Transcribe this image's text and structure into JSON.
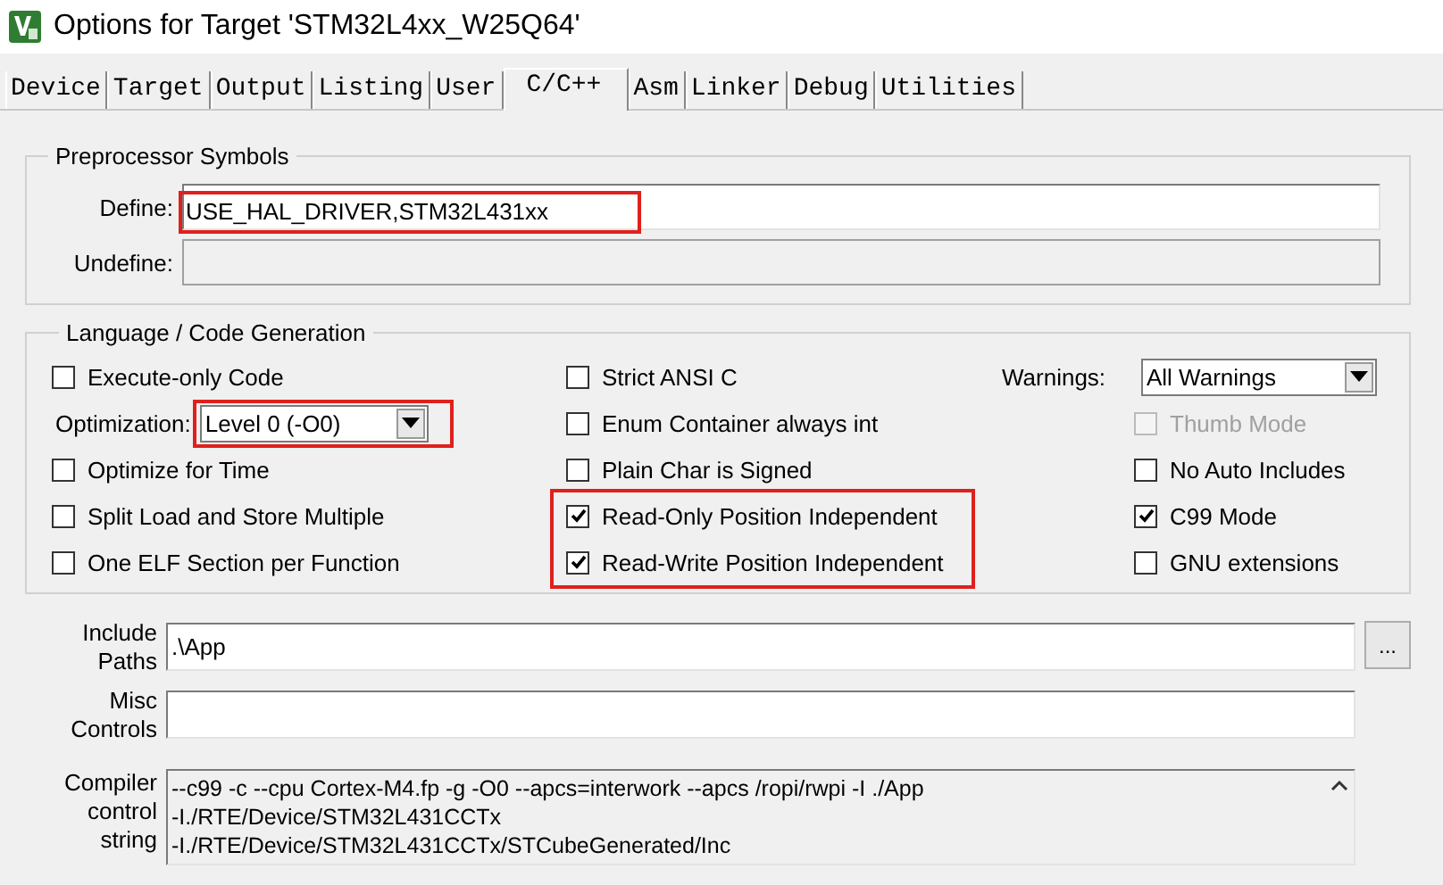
{
  "window": {
    "title": "Options for Target 'STM32L4xx_W25Q64'"
  },
  "tabs": [
    {
      "label": "Device",
      "selected": false
    },
    {
      "label": "Target",
      "selected": false
    },
    {
      "label": "Output",
      "selected": false
    },
    {
      "label": "Listing",
      "selected": false
    },
    {
      "label": "User",
      "selected": false
    },
    {
      "label": "C/C++",
      "selected": true
    },
    {
      "label": "Asm",
      "selected": false
    },
    {
      "label": "Linker",
      "selected": false
    },
    {
      "label": "Debug",
      "selected": false
    },
    {
      "label": "Utilities",
      "selected": false
    }
  ],
  "preprocessor": {
    "title": "Preprocessor Symbols",
    "define": {
      "label": "Define:",
      "value": "USE_HAL_DRIVER,STM32L431xx",
      "highlighted": true
    },
    "undefine": {
      "label": "Undefine:",
      "disabled": true
    }
  },
  "language": {
    "title": "Language / Code Generation",
    "columns": [
      [
        {
          "kind": "checkbox",
          "label": "Execute-only Code",
          "checked": false,
          "disabled": false,
          "highlighted": false
        },
        {
          "kind": "select",
          "label": "Optimization:",
          "value": "Level 0 (-O0)",
          "highlighted": true
        },
        {
          "kind": "checkbox",
          "label": "Optimize for Time",
          "checked": false,
          "disabled": false,
          "highlighted": false
        },
        {
          "kind": "checkbox",
          "label": "Split Load and Store Multiple",
          "checked": false,
          "disabled": false,
          "highlighted": false
        },
        {
          "kind": "checkbox",
          "label": "One ELF Section per Function",
          "checked": false,
          "disabled": false,
          "highlighted": false
        }
      ],
      [
        {
          "kind": "checkbox",
          "label": "Strict ANSI C",
          "checked": false,
          "disabled": false,
          "highlighted": false
        },
        {
          "kind": "checkbox",
          "label": "Enum Container always int",
          "checked": false,
          "disabled": false,
          "highlighted": false
        },
        {
          "kind": "checkbox",
          "label": "Plain Char is Signed",
          "checked": false,
          "disabled": false,
          "highlighted": false
        },
        {
          "kind": "checkbox",
          "label": "Read-Only Position Independent",
          "checked": true,
          "disabled": false,
          "highlighted": true
        },
        {
          "kind": "checkbox",
          "label": "Read-Write Position Independent",
          "checked": true,
          "disabled": false,
          "highlighted": true
        }
      ],
      [
        {
          "kind": "select",
          "label": "Warnings:",
          "value": "All Warnings",
          "highlighted": false
        },
        {
          "kind": "checkbox",
          "label": "Thumb Mode",
          "checked": false,
          "disabled": true,
          "highlighted": false
        },
        {
          "kind": "checkbox",
          "label": "No Auto Includes",
          "checked": false,
          "disabled": false,
          "highlighted": false
        },
        {
          "kind": "checkbox",
          "label": "C99 Mode",
          "checked": true,
          "disabled": false,
          "highlighted": false
        },
        {
          "kind": "checkbox",
          "label": "GNU extensions",
          "checked": false,
          "disabled": false,
          "highlighted": false
        }
      ]
    ]
  },
  "include_paths": {
    "label": "Include Paths",
    "value": ".\\App",
    "browse_button": "..."
  },
  "misc_controls": {
    "label": "Misc Controls"
  },
  "compiler_control_string": {
    "label": "Compiler control string",
    "lines": [
      "--c99 -c --cpu Cortex-M4.fp -g -O0 --apcs=interwork --apcs /ropi/rwpi -I ./App",
      "-I./RTE/Device/STM32L431CCTx",
      "-I./RTE/Device/STM32L431CCTx/STCubeGenerated/Inc"
    ]
  }
}
